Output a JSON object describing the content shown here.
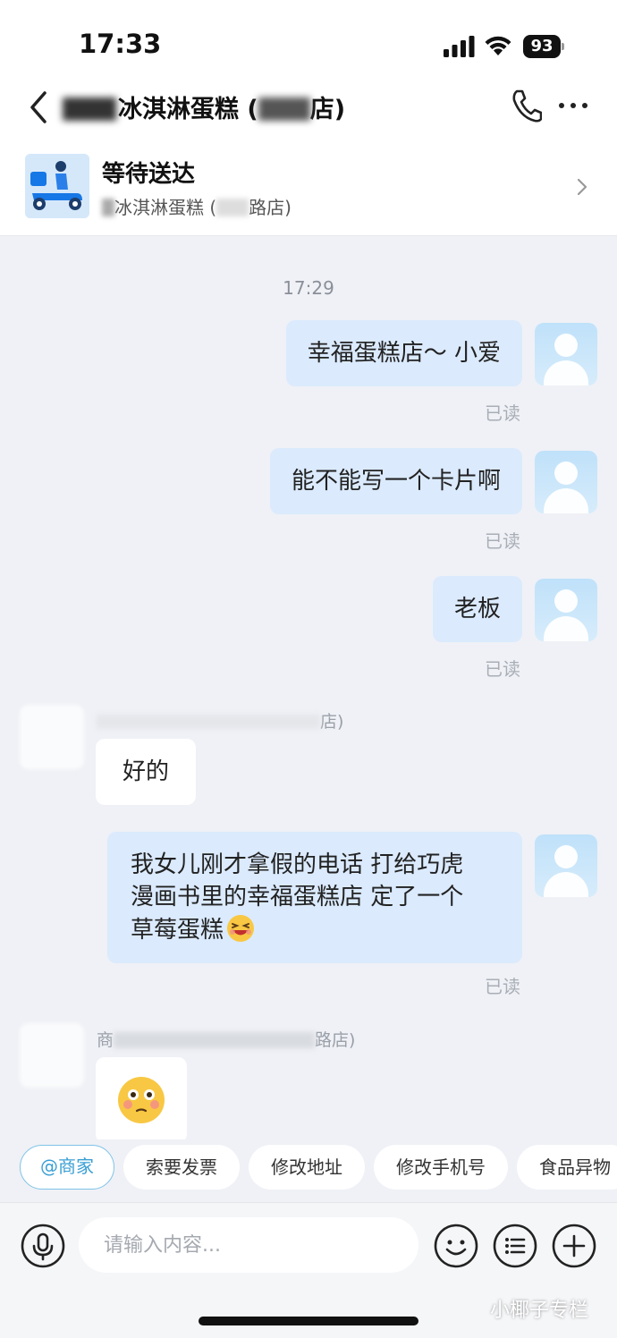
{
  "status_bar": {
    "time": "17:33",
    "battery": "93"
  },
  "nav": {
    "title": "冰淇淋蛋糕 (",
    "title_suffix": "店)",
    "back_icon": "chevron-left-icon",
    "call_icon": "phone-icon",
    "more_icon": "more-dots-icon"
  },
  "order": {
    "status": "等待送达",
    "shop": "冰淇淋蛋糕 (",
    "shop_suffix": "路店)",
    "thumb_icon": "delivery-scooter-icon"
  },
  "chat": {
    "timestamp": "17:29",
    "messages": [
      {
        "from": "me",
        "text": "幸福蛋糕店～ 小爱",
        "read": "已读"
      },
      {
        "from": "me",
        "text": "能不能写一个卡片啊",
        "read": "已读"
      },
      {
        "from": "me",
        "text": "老板",
        "read": "已读"
      },
      {
        "from": "shop",
        "sender": "店)",
        "text": "好的"
      },
      {
        "from": "me",
        "lines": [
          "我女儿刚才拿假的电话 打给巧虎",
          "漫画书里的幸福蛋糕店 定了一个",
          "草莓蛋糕"
        ],
        "emoji": "grinning-squint-icon",
        "read": "已读"
      },
      {
        "from": "shop",
        "sender_prefix": "商",
        "sender_suffix": "路店)",
        "emoji": "flushed-face-icon"
      }
    ]
  },
  "quick_replies": [
    "@商家",
    "索要发票",
    "修改地址",
    "修改手机号",
    "食品异物"
  ],
  "input": {
    "placeholder": "请输入内容...",
    "value": ""
  },
  "watermark": "小椰子专栏",
  "colors": {
    "bubble_out": "#dbeafd",
    "bubble_in": "#ffffff",
    "background": "#eff1f6",
    "accent": "#3a9fd4"
  }
}
